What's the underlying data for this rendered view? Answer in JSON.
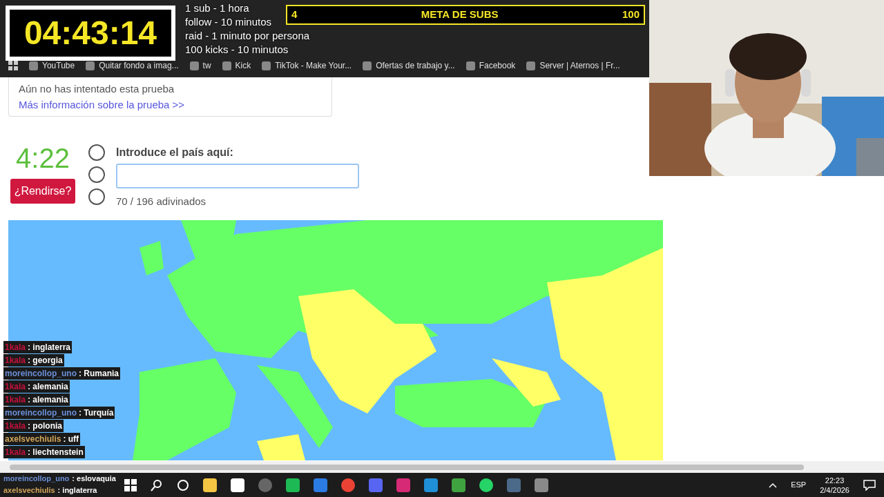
{
  "stream_overlay": {
    "timer": "04:43:14",
    "rules": [
      "1 sub - 1 hora",
      "follow - 10 minutos",
      "raid - 1 minuto por persona",
      "100 kicks - 10 minutos"
    ],
    "subs_goal": {
      "current": "4",
      "title": "META DE SUBS",
      "target": "100"
    }
  },
  "bookmarks": [
    "YouTube",
    "Quitar fondo a imag...",
    "tw",
    "Kick",
    "TikTok - Make Your...",
    "Ofertas de trabajo y...",
    "Facebook",
    "Server | Aternos | Fr..."
  ],
  "quiz": {
    "notice": "Aún no has intentado esta prueba",
    "more_link": "Más información sobre la prueba >>",
    "time_left": "4:22",
    "give_up": "¿Rendirse?",
    "input_label": "Introduce el país aquí:",
    "progress": "70 / 196 adivinados"
  },
  "chat": [
    {
      "user": "1kala",
      "text": ": inglaterra",
      "color": "#c8103c"
    },
    {
      "user": "1kala",
      "text": ": georgia",
      "color": "#c8103c"
    },
    {
      "user": "moreincollop_uno",
      "text": ": Rumania",
      "color": "#6a8fd8"
    },
    {
      "user": "1kala",
      "text": ": alemania",
      "color": "#c8103c"
    },
    {
      "user": "1kala",
      "text": ": alemania",
      "color": "#c8103c"
    },
    {
      "user": "moreincollop_uno",
      "text": ": Turquía",
      "color": "#6a8fd8"
    },
    {
      "user": "1kala",
      "text": ": polonia",
      "color": "#c8103c"
    },
    {
      "user": "axelsvechiulis",
      "text": ": uff",
      "color": "#d2a65a"
    },
    {
      "user": "1kala",
      "text": ": liechtenstein",
      "color": "#c8103c"
    },
    {
      "user": "moreincollop_uno",
      "text": ": eslovaquia",
      "color": "#6a8fd8"
    },
    {
      "user": "axelsvechiulis",
      "text": ": inglaterra",
      "color": "#d2a65a"
    }
  ],
  "taskbar": {
    "language": "ESP",
    "time": "22:23",
    "date": "2/4/2026"
  }
}
